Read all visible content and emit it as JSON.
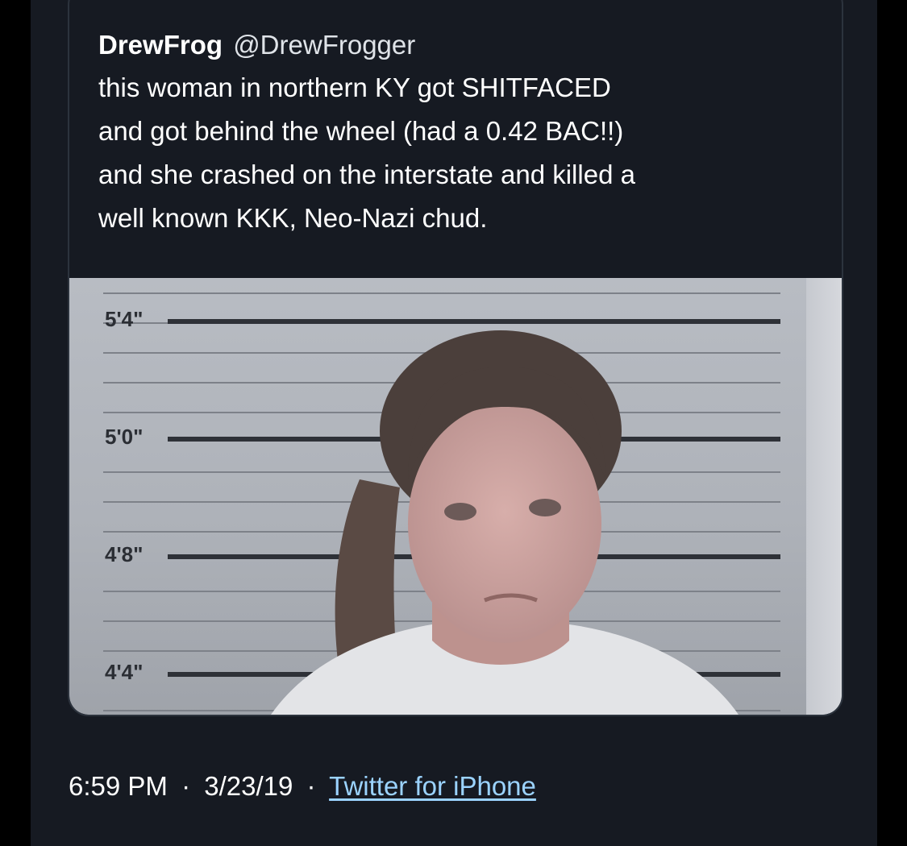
{
  "tweet": {
    "display_name": "DrewFrog",
    "handle": "@DrewFrogger",
    "text_lines": [
      "this woman in northern KY got SHITFACED",
      "and got behind the wheel (had a 0.42 BAC!!)",
      "and she crashed on the interstate and killed a",
      "well known KKK, Neo-Nazi chud."
    ]
  },
  "photo": {
    "height_labels": [
      "5'4\"",
      "5'0\"",
      "4'8\"",
      "4'4\""
    ]
  },
  "footer": {
    "time": "6:59 PM",
    "date": "3/23/19",
    "separator": "·",
    "source": "Twitter for iPhone"
  },
  "colors": {
    "background": "#161a22",
    "link": "#9bd3ff",
    "text": "#ffffff"
  }
}
